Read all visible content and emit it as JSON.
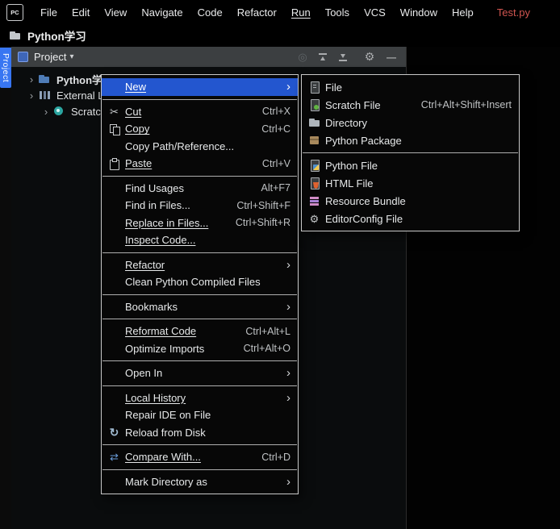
{
  "colors": {
    "selection_blue": "#2356cf",
    "stripe_tab_blue": "#3876f2",
    "panel_header_gray": "#3c3f41",
    "file_label_red": "#d15550",
    "menu_border": "#c9c9c9",
    "background": "#000000"
  },
  "icons": {
    "tree-chevron": "›",
    "chevron-down": "▾",
    "submenu-arrow": "›",
    "locate": "◎",
    "settings": "⚙",
    "hide": "—",
    "scissors": "✂",
    "reload": "↻",
    "compare": "⇄",
    "editorconfig": "⚙"
  },
  "menubar": {
    "logo_text": "PC",
    "items": [
      {
        "label": "File"
      },
      {
        "label": "Edit"
      },
      {
        "label": "View"
      },
      {
        "label": "Navigate"
      },
      {
        "label": "Code"
      },
      {
        "label": "Refactor"
      },
      {
        "label": "Run",
        "underline": true
      },
      {
        "label": "Tools"
      },
      {
        "label": "VCS"
      },
      {
        "label": "Window"
      },
      {
        "label": "Help"
      }
    ],
    "file_label": "Test.py"
  },
  "project_bar": {
    "title": "Python学习"
  },
  "tool_window_stripe": {
    "tab_label": "Project"
  },
  "project_panel": {
    "header": {
      "title": "Project",
      "toolbar_icons": [
        "locate",
        "collapse-all",
        "expand-all",
        "settings",
        "hide"
      ]
    },
    "tree": [
      {
        "label": "Python学习",
        "icon": "folder",
        "chevron": true,
        "indent": 18,
        "bold": true
      },
      {
        "label": "External Libraries",
        "icon": "libraries",
        "chevron": true,
        "indent": 18
      },
      {
        "label": "Scratches and Consoles",
        "icon": "scratches",
        "chevron": true,
        "indent": 36
      }
    ]
  },
  "context_menu": {
    "groups": [
      [
        {
          "label": "New",
          "underline": true,
          "selected": true,
          "submenu": true
        }
      ],
      [
        {
          "label": "Cut",
          "icon": "scissors",
          "underline": true,
          "shortcut": "Ctrl+X"
        },
        {
          "label": "Copy",
          "icon": "copy",
          "underline": true,
          "shortcut": "Ctrl+C"
        },
        {
          "label": "Copy Path/Reference..."
        },
        {
          "label": "Paste",
          "icon": "paste",
          "underline": true,
          "shortcut": "Ctrl+V"
        }
      ],
      [
        {
          "label": "Find Usages",
          "shortcut": "Alt+F7"
        },
        {
          "label": "Find in Files...",
          "shortcut": "Ctrl+Shift+F"
        },
        {
          "label": "Replace in Files...",
          "underline": true,
          "shortcut": "Ctrl+Shift+R"
        },
        {
          "label": "Inspect Code...",
          "underline": true
        }
      ],
      [
        {
          "label": "Refactor",
          "underline": true,
          "submenu": true
        },
        {
          "label": "Clean Python Compiled Files"
        }
      ],
      [
        {
          "label": "Bookmarks",
          "submenu": true
        }
      ],
      [
        {
          "label": "Reformat Code",
          "underline": true,
          "shortcut": "Ctrl+Alt+L"
        },
        {
          "label": "Optimize Imports",
          "shortcut": "Ctrl+Alt+O"
        }
      ],
      [
        {
          "label": "Open In",
          "submenu": true
        }
      ],
      [
        {
          "label": "Local History",
          "underline": true,
          "submenu": true
        },
        {
          "label": "Repair IDE on File"
        },
        {
          "label": "Reload from Disk",
          "icon": "reload"
        }
      ],
      [
        {
          "label": "Compare With...",
          "icon": "compare",
          "underline": true,
          "shortcut": "Ctrl+D"
        }
      ],
      [
        {
          "label": "Mark Directory as",
          "submenu": true
        }
      ]
    ]
  },
  "new_submenu": {
    "groups": [
      [
        {
          "label": "File",
          "icon": "file"
        },
        {
          "label": "Scratch File",
          "icon": "scratch-file",
          "shortcut": "Ctrl+Alt+Shift+Insert"
        },
        {
          "label": "Directory",
          "icon": "directory"
        },
        {
          "label": "Python Package",
          "icon": "python-package"
        }
      ],
      [
        {
          "label": "Python File",
          "icon": "python-file"
        },
        {
          "label": "HTML File",
          "icon": "html-file"
        },
        {
          "label": "Resource Bundle",
          "icon": "resource-bundle"
        },
        {
          "label": "EditorConfig File",
          "icon": "editorconfig"
        }
      ]
    ]
  }
}
